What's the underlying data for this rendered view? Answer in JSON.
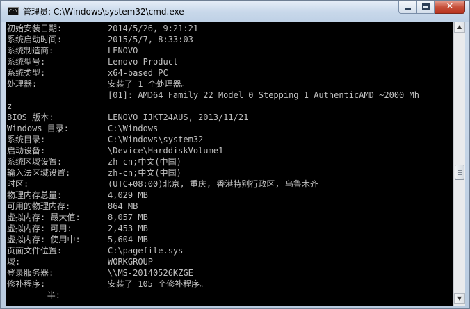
{
  "window": {
    "title": "管理员: C:\\Windows\\system32\\cmd.exe",
    "icon_text": "C:\\"
  },
  "caption_buttons": {
    "minimize_icon": "minimize-icon",
    "maximize_icon": "maximize-icon",
    "close_icon": "close-icon",
    "close_glyph": "✕"
  },
  "console": {
    "lines": [
      {
        "label": "初始安装日期:",
        "value": "2014/5/26, 9:21:21"
      },
      {
        "label": "系统启动时间:",
        "value": "2015/5/7, 8:33:03"
      },
      {
        "label": "系统制造商:",
        "value": "LENOVO"
      },
      {
        "label": "系统型号:",
        "value": "Lenovo Product"
      },
      {
        "label": "系统类型:",
        "value": "x64-based PC"
      },
      {
        "label": "处理器:",
        "value": "安装了 1 个处理器。"
      },
      {
        "label": "",
        "value": "[01]: AMD64 Family 22 Model 0 Stepping 1 AuthenticAMD ~2000 Mh"
      },
      {
        "label": "z",
        "value": ""
      },
      {
        "label": "BIOS 版本:",
        "value": "LENOVO IJKT24AUS, 2013/11/21"
      },
      {
        "label": "Windows 目录:",
        "value": "C:\\Windows"
      },
      {
        "label": "系统目录:",
        "value": "C:\\Windows\\system32"
      },
      {
        "label": "启动设备:",
        "value": "\\Device\\HarddiskVolume1"
      },
      {
        "label": "系统区域设置:",
        "value": "zh-cn;中文(中国)"
      },
      {
        "label": "输入法区域设置:",
        "value": "zh-cn;中文(中国)"
      },
      {
        "label": "时区:",
        "value": "(UTC+08:00)北京, 重庆, 香港特别行政区, 乌鲁木齐"
      },
      {
        "label": "物理内存总量:",
        "value": "4,029 MB"
      },
      {
        "label": "可用的物理内存:",
        "value": "864 MB"
      },
      {
        "label": "虚拟内存: 最大值:",
        "value": "8,057 MB"
      },
      {
        "label": "虚拟内存: 可用:",
        "value": "2,453 MB"
      },
      {
        "label": "虚拟内存: 使用中:",
        "value": "5,604 MB"
      },
      {
        "label": "页面文件位置:",
        "value": "C:\\pagefile.sys"
      },
      {
        "label": "域:",
        "value": "WORKGROUP"
      },
      {
        "label": "登录服务器:",
        "value": "\\\\MS-20140526KZGE"
      },
      {
        "label": "修补程序:",
        "value": "安装了 105 个修补程序。"
      },
      {
        "label": "        半:",
        "value": ""
      }
    ]
  },
  "scrollbar": {
    "up_arrow": "▲",
    "down_arrow": "▼"
  }
}
